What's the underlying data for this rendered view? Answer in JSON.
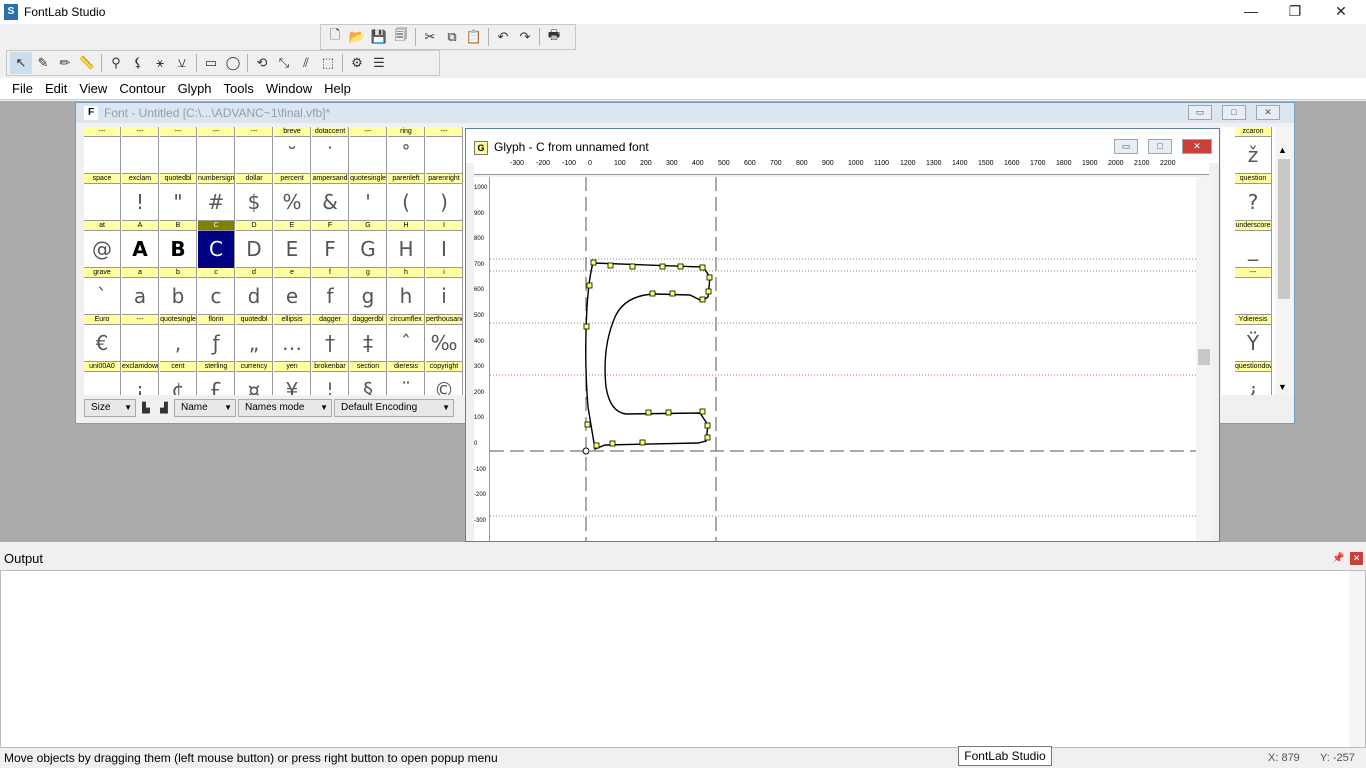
{
  "app": {
    "title": "FontLab Studio"
  },
  "window_controls": {
    "minimize": "—",
    "maximize": "❐",
    "close": "✕"
  },
  "menu": [
    "File",
    "Edit",
    "View",
    "Contour",
    "Glyph",
    "Tools",
    "Window",
    "Help"
  ],
  "font_window": {
    "title": "Font - Untitled [C:\\...\\ADVANC~1\\final.vfb]*",
    "grid_rows": [
      {
        "labels": [
          "---",
          "---",
          "---",
          "---",
          "---",
          "breve",
          "dotaccent",
          "---",
          "ring",
          "---"
        ],
        "glyphs": [
          "",
          "",
          "",
          "",
          "",
          "˘",
          "˙",
          "",
          "˚",
          ""
        ]
      },
      {
        "labels": [
          "space",
          "exclam",
          "quotedbl",
          "numbersign",
          "dollar",
          "percent",
          "ampersand",
          "quotesingle",
          "parenleft",
          "parenright"
        ],
        "glyphs": [
          "",
          "!",
          "\"",
          "#",
          "$",
          "%",
          "&",
          "'",
          "(",
          ")"
        ]
      },
      {
        "labels": [
          "at",
          "A",
          "B",
          "C",
          "D",
          "E",
          "F",
          "G",
          "H",
          "I"
        ],
        "glyphs": [
          "@",
          "A",
          "B",
          "C",
          "D",
          "E",
          "F",
          "G",
          "H",
          "I"
        ]
      },
      {
        "labels": [
          "grave",
          "a",
          "b",
          "c",
          "d",
          "e",
          "f",
          "g",
          "h",
          "i"
        ],
        "glyphs": [
          "`",
          "a",
          "b",
          "c",
          "d",
          "e",
          "f",
          "g",
          "h",
          "i"
        ]
      },
      {
        "labels": [
          "Euro",
          "---",
          "quotesingle",
          "florin",
          "quotedbl",
          "ellipsis",
          "dagger",
          "daggerdbl",
          "circumflex",
          "perthousand"
        ],
        "glyphs": [
          "€",
          "",
          ",",
          "ƒ",
          "„",
          "…",
          "†",
          "‡",
          "ˆ",
          "‰"
        ]
      },
      {
        "labels": [
          "uni00A0",
          "exclamdown",
          "cent",
          "sterling",
          "currency",
          "yen",
          "brokenbar",
          "section",
          "dieresis",
          "copyright"
        ],
        "glyphs": [
          "",
          "¡",
          "¢",
          "£",
          "¤",
          "¥",
          "¦",
          "§",
          "¨",
          "©"
        ]
      }
    ],
    "right_labels": [
      "zcaron",
      "question",
      "underscore",
      "---",
      "Ydieresis",
      "questiondown"
    ],
    "right_glyphs": [
      "ž",
      "?",
      "_",
      "",
      "Ÿ",
      "¿"
    ],
    "toolbar": {
      "size": "Size",
      "name": "Name",
      "names_mode": "Names mode",
      "encoding": "Default Encoding"
    }
  },
  "glyph_window": {
    "title": "Glyph - C from unnamed font",
    "ruler_x": [
      "-300",
      "-200",
      "-100",
      "0",
      "100",
      "200",
      "300",
      "400",
      "500",
      "600",
      "700",
      "800",
      "900",
      "1000",
      "1100",
      "1200",
      "1300",
      "1400",
      "1500",
      "1600",
      "1700",
      "1800",
      "1900",
      "2000",
      "2100",
      "2200"
    ],
    "ruler_y": [
      "1000",
      "900",
      "800",
      "700",
      "600",
      "500",
      "400",
      "300",
      "200",
      "100",
      "0",
      "-100",
      "-200",
      "-300"
    ]
  },
  "output": {
    "title": "Output"
  },
  "status": {
    "message": "Move objects by dragging them (left mouse button) or press right button to open popup menu",
    "tooltip": "FontLab Studio",
    "x": "X: 879",
    "y": "Y: -257"
  }
}
